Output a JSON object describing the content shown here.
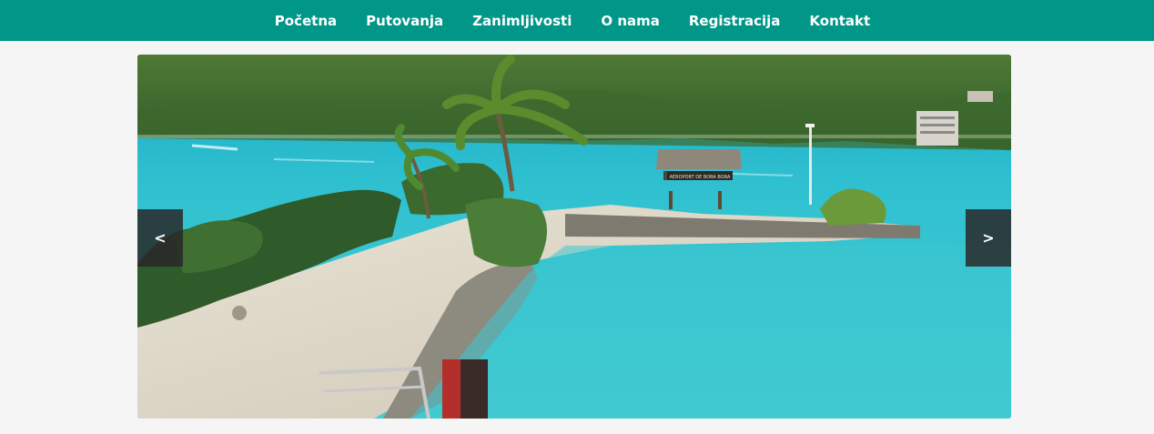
{
  "nav": {
    "items": [
      {
        "label": "Početna"
      },
      {
        "label": "Putovanja"
      },
      {
        "label": "Zanimljivosti"
      },
      {
        "label": "O nama"
      },
      {
        "label": "Registracija"
      },
      {
        "label": "Kontakt"
      }
    ]
  },
  "slider": {
    "prev_label": "<",
    "next_label": ">",
    "sign_text": "AEROPORT DE BORA BORA"
  },
  "colors": {
    "nav_bg": "#009688",
    "page_bg": "#f5f5f5",
    "lagoon": "#3cc7cf"
  }
}
